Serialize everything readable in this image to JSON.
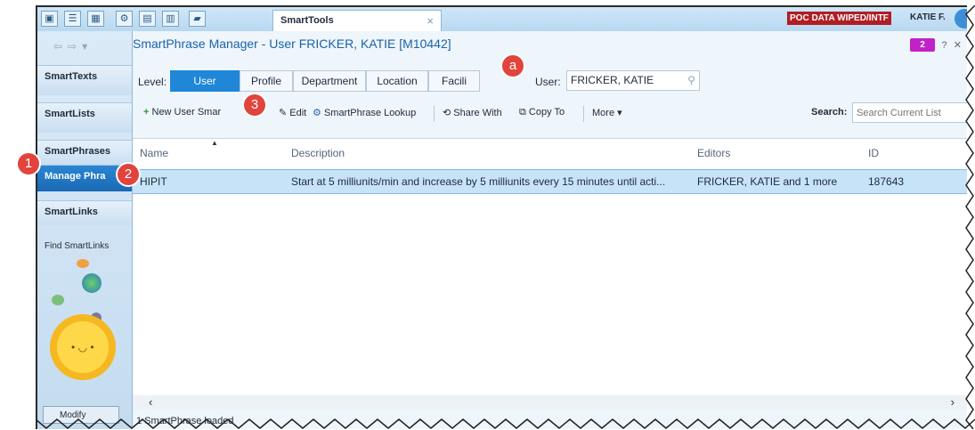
{
  "topbar": {
    "tab_title": "SmartTools",
    "tab_close": "×",
    "environment_badge": "POC DATA WIPED/INTF",
    "user_chip": "KATIE F."
  },
  "sidebar": {
    "items": [
      {
        "label": "SmartTexts"
      },
      {
        "label": "SmartLists"
      },
      {
        "label": "SmartPhrases"
      },
      {
        "label": "Manage Phra"
      },
      {
        "label": "SmartLinks"
      }
    ],
    "find_link": "Find SmartLinks",
    "modify": "Modify"
  },
  "header": {
    "title": "SmartPhrase Manager - User FRICKER, KATIE [M10442]",
    "badge_count": "2"
  },
  "level": {
    "label": "Level:",
    "options": [
      "User",
      "Profile",
      "Department",
      "Location",
      "Facili"
    ],
    "selected": "User"
  },
  "user_field": {
    "label": "User:",
    "value": "FRICKER, KATIE"
  },
  "toolbar": {
    "new": "New User Smar",
    "edit": "Edit",
    "lookup": "SmartPhrase Lookup",
    "share": "Share With",
    "copy": "Copy To",
    "more": "More",
    "search_label": "Search:",
    "search_placeholder": "Search Current List"
  },
  "table": {
    "columns": [
      "Name",
      "Description",
      "Editors",
      "ID"
    ],
    "rows": [
      {
        "name": "HIPIT",
        "description": "Start at 5 milliunits/min and increase by 5 milliunits every 15 minutes until acti...",
        "editors": "FRICKER, KATIE and 1 more",
        "id": "187643"
      }
    ]
  },
  "status": "1 SmartPhrase loaded",
  "callouts": [
    "1",
    "2",
    "3",
    "a"
  ],
  "colors": {
    "accent": "#1f86d8",
    "callout": "#e0443c",
    "selected_row": "#c7e3f8",
    "env_badge": "#b01e23"
  }
}
